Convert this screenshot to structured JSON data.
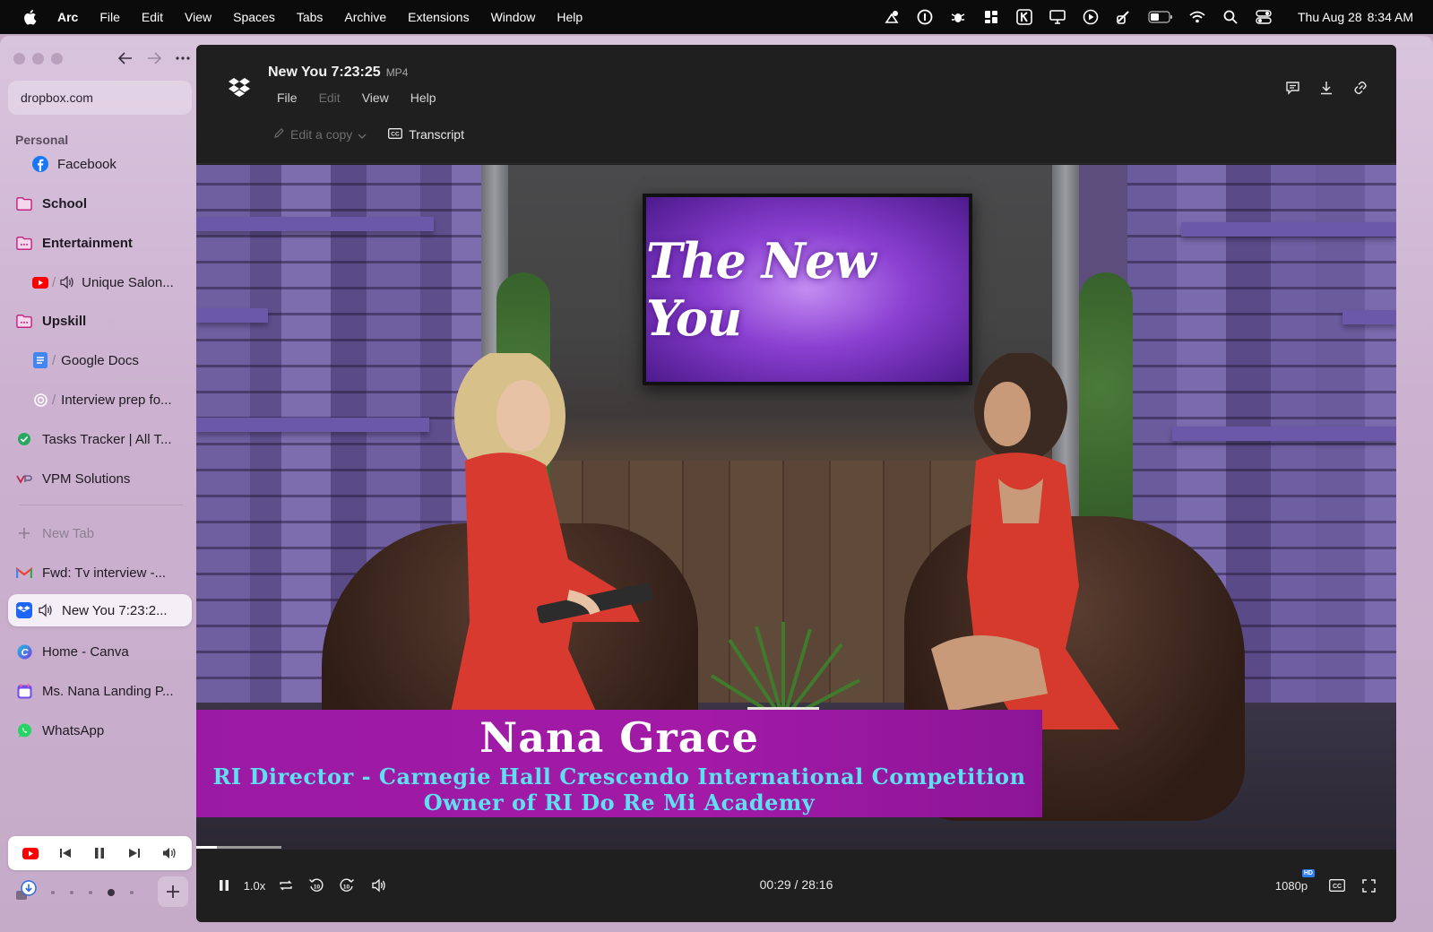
{
  "menubar": {
    "app": "Arc",
    "items": [
      "File",
      "Edit",
      "View",
      "Spaces",
      "Tabs",
      "Archive",
      "Extensions",
      "Window",
      "Help"
    ],
    "date": "Thu Aug 28",
    "time": "8:34 AM"
  },
  "sidebar": {
    "url": "dropbox.com",
    "section": "Personal",
    "items": [
      {
        "label": "Facebook"
      },
      {
        "label": "School"
      },
      {
        "label": "Entertainment"
      },
      {
        "label": "Unique Salon..."
      },
      {
        "label": "Upskill"
      },
      {
        "label": "Google Docs"
      },
      {
        "label": "Interview prep fo..."
      },
      {
        "label": "Tasks Tracker | All T..."
      },
      {
        "label": "VPM Solutions"
      },
      {
        "label": "New Tab"
      },
      {
        "label": "Fwd: Tv interview -..."
      },
      {
        "label": "New You 7:23:2..."
      },
      {
        "label": "Home - Canva"
      },
      {
        "label": "Ms. Nana Landing P..."
      },
      {
        "label": "WhatsApp"
      }
    ]
  },
  "viewer": {
    "title": "New You 7:23:25",
    "format": "MP4",
    "menu": [
      "File",
      "Edit",
      "View",
      "Help"
    ],
    "edit_copy": "Edit a copy",
    "transcript": "Transcript"
  },
  "video": {
    "tv_text": "The New You",
    "lower_third": {
      "name": "Nana Grace",
      "role": "RI Director - Carnegie Hall Crescendo International Competition",
      "role2": "Owner of RI Do Re Mi Academy"
    },
    "progress_fraction": 0.017
  },
  "controls": {
    "speed": "1.0x",
    "time": "00:29 / 28:16",
    "quality": "1080p",
    "hd": "HD"
  },
  "colors": {
    "accent": "#2d7df6",
    "lower_third": "#a21aa6",
    "lower_third_text": "#5fe0f0"
  }
}
